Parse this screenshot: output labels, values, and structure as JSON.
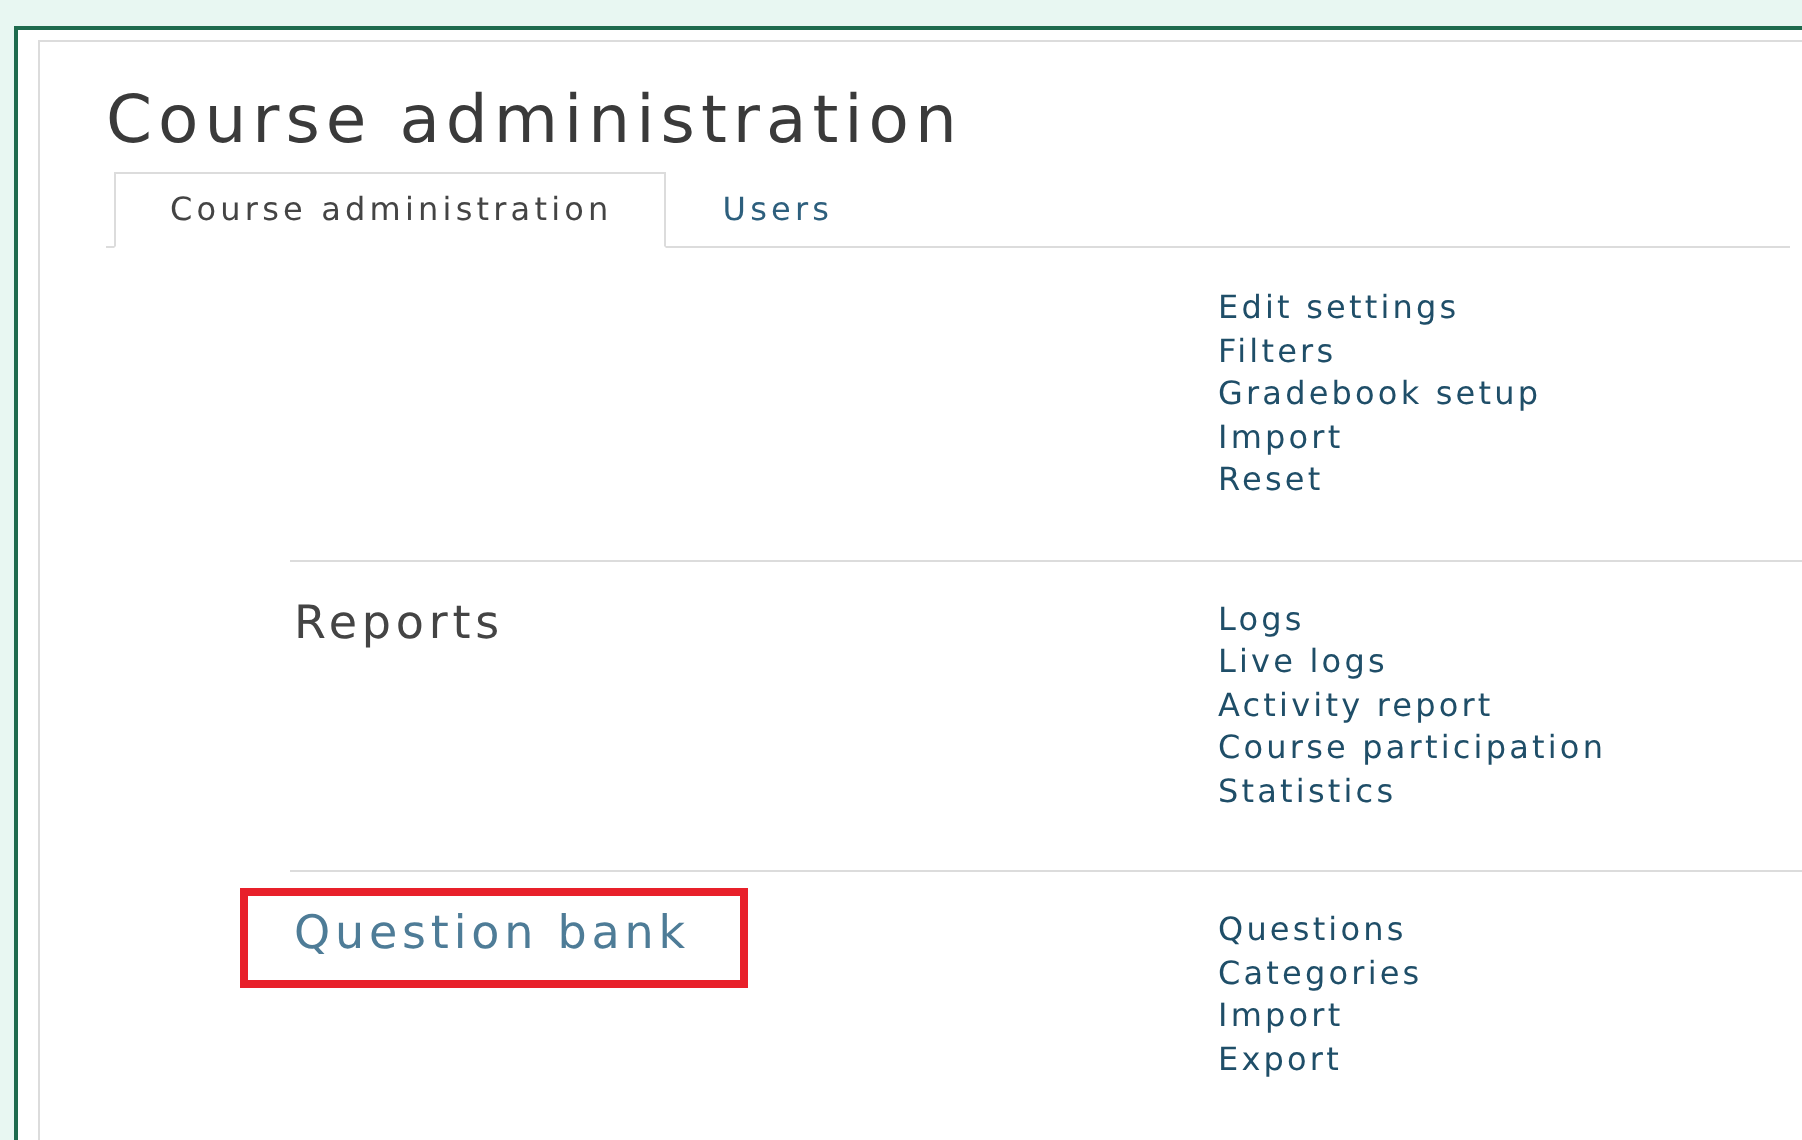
{
  "page_title": "Course administration",
  "tabs": [
    {
      "label": "Course administration",
      "selected": true
    },
    {
      "label": "Users",
      "selected": false
    }
  ],
  "sections": [
    {
      "highlighted": false,
      "links": [
        "Edit settings",
        "Filters",
        "Gradebook setup",
        "Import",
        "Reset"
      ]
    },
    {
      "title": "Reports",
      "highlighted": false,
      "links": [
        "Logs",
        "Live logs",
        "Activity report",
        "Course participation",
        "Statistics"
      ]
    },
    {
      "title": "Question bank",
      "highlighted": true,
      "links": [
        "Questions",
        "Categories",
        "Import",
        "Export"
      ]
    }
  ]
}
